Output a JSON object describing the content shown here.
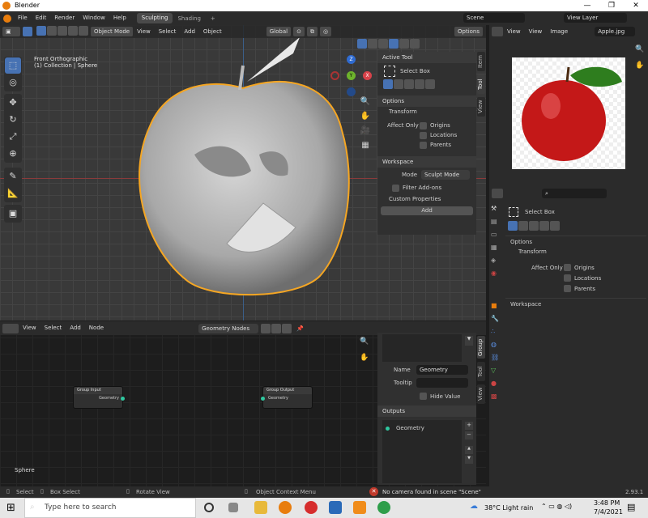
{
  "window": {
    "title": "Blender",
    "minimize": "—",
    "maximize": "❐",
    "close": "✕"
  },
  "menubar": {
    "items": [
      "File",
      "Edit",
      "Render",
      "Window",
      "Help"
    ],
    "workspace_tabs": [
      "Sculpting",
      "Shading"
    ],
    "add_tab": "+",
    "scene": "Scene",
    "view_layer": "View Layer"
  },
  "viewport": {
    "mode": "Object Mode",
    "menus": [
      "View",
      "Select",
      "Add",
      "Object"
    ],
    "transform": "Global",
    "options": "Options",
    "overlay_line1": "Front Orthographic",
    "overlay_line2": "(1) Collection | Sphere",
    "gizmo": {
      "z": "Z",
      "y": "Y",
      "x": "X"
    },
    "npanel": {
      "active_tool": "Active Tool",
      "select_box": "Select Box",
      "options": "Options",
      "transform": "Transform",
      "affect_only": "Affect Only",
      "origins": "Origins",
      "locations": "Locations",
      "parents": "Parents",
      "workspace": "Workspace",
      "mode_label": "Mode",
      "mode_value": "Sculpt Mode",
      "filter_addons": "Filter Add-ons",
      "custom_properties": "Custom Properties",
      "add": "Add",
      "tabs": [
        "Item",
        "Tool",
        "View"
      ]
    }
  },
  "image_editor": {
    "menus": [
      "View",
      "View",
      "Image"
    ],
    "image_name": "Apple.jpg"
  },
  "properties": {
    "select_box": "Select Box",
    "options": "Options",
    "transform": "Transform",
    "affect_only": "Affect Only",
    "origins": "Origins",
    "locations": "Locations",
    "parents": "Parents",
    "workspace": "Workspace"
  },
  "node_editor": {
    "menus": [
      "View",
      "Select",
      "Add",
      "Node"
    ],
    "tree_name": "Geometry Nodes",
    "group_input": "Group Input",
    "group_output": "Group Output",
    "geometry": "Geometry",
    "object_label": "Sphere",
    "side": {
      "name_label": "Name",
      "name_value": "Geometry",
      "tooltip_label": "Tooltip",
      "hide_value": "Hide Value",
      "outputs": "Outputs",
      "output_item": "Geometry",
      "tabs": [
        "Group",
        "Tool",
        "View"
      ]
    }
  },
  "statusbar": {
    "select": "Select",
    "box_select": "Box Select",
    "rotate_view": "Rotate View",
    "context_menu": "Object Context Menu",
    "warning": "No camera found in scene \"Scene\"",
    "version": "2.93.1"
  },
  "taskbar": {
    "search_placeholder": "Type here to search",
    "weather": "38°C  Light rain",
    "time": "3:48 PM",
    "date": "7/4/2021"
  },
  "colors": {
    "accent": "#4772b3",
    "outline": "#f5a623",
    "socket": "#2fc8a0",
    "error": "#c0392b"
  }
}
